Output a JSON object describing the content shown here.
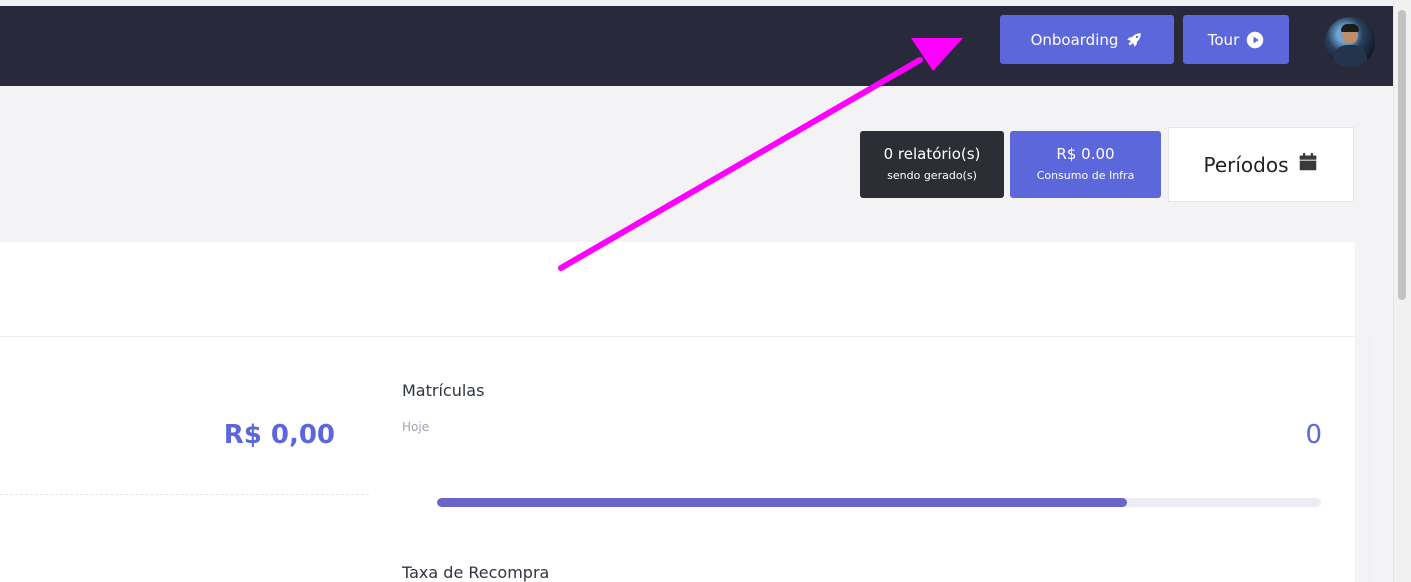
{
  "header": {
    "onboarding_label": "Onboarding",
    "tour_label": "Tour"
  },
  "status": {
    "reports_count": "0 relatório(s)",
    "reports_sub": "sendo gerado(s)",
    "infra_value": "R$ 0.00",
    "infra_sub": "Consumo de Infra",
    "periods_label": "Períodos"
  },
  "summary": {
    "amount": "R$ 0,00"
  },
  "metrics": {
    "matriculas": {
      "title": "Matrículas",
      "period": "Hoje",
      "value": "0",
      "progress": 0.78
    },
    "taxa_recompra": {
      "title": "Taxa de Recompra"
    }
  },
  "icons": {
    "onboarding": "rocket-icon",
    "tour": "play-circle-icon",
    "periods": "calendar-icon"
  },
  "colors": {
    "topbar": "#282a3b",
    "accent": "#5c67dc",
    "progress": "#6965c9",
    "annotation_arrow": "#ff00ff"
  }
}
